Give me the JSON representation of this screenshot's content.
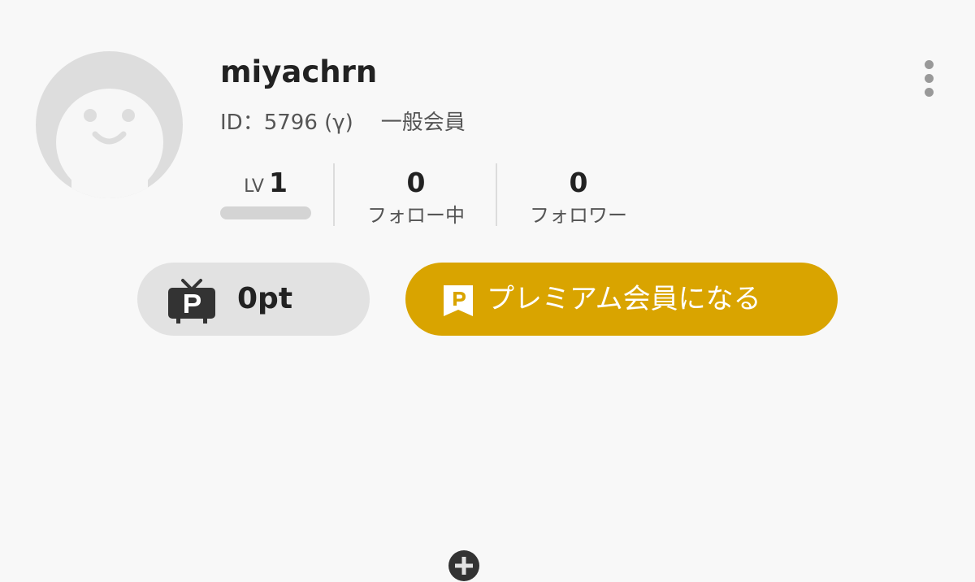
{
  "profile": {
    "username": "miyachrn",
    "id_text": "ID：5796 (γ)",
    "rank": "一般会員",
    "avatar_icon": "default-avatar-face-icon"
  },
  "stats": {
    "level_label": "LV",
    "level_value": "1",
    "following_count": "0",
    "following_label": "フォロー中",
    "followers_count": "0",
    "followers_label": "フォロワー"
  },
  "points": {
    "text": "0pt",
    "icon": "tv-points-icon",
    "add_icon": "plus-circle-icon"
  },
  "premium": {
    "label": "プレミアム会員になる",
    "icon": "premium-flag-icon"
  },
  "menu": {
    "icon": "more-vertical-icon"
  },
  "colors": {
    "background": "#f8f8f8",
    "premium_gold": "#d9a400",
    "points_button_bg": "#e2e2e2",
    "avatar_bg": "#dddddd",
    "text_dark": "#222222",
    "text_muted": "#555555"
  }
}
